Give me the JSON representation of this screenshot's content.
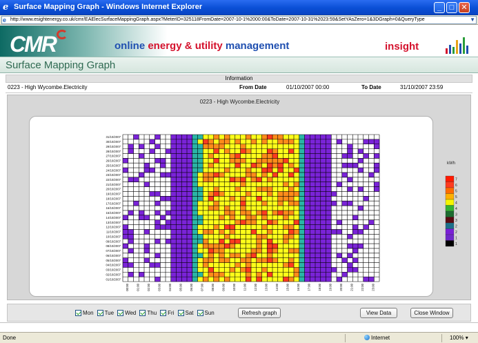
{
  "window": {
    "title": "Surface Mapping Graph - Windows Internet Explorer",
    "url": "http://www.esightenergy.co.uk/cmr/EAElecSurfaceMappingGraph.aspx?MeterID=325118FromDate=2007-10-1%2000:00&ToDate=2007-10-31%2023:59&SetYAsZero=1&3DGraph=0&QueryType"
  },
  "header": {
    "logo_text": "CMR",
    "tagline_online": "online",
    "tagline_energy": "energy & utility",
    "tagline_management": "management",
    "insight": "insight",
    "page_title": "Surface Mapping Graph"
  },
  "info": {
    "heading": "Information",
    "meter": "0223 - High Wycombe.Electricity",
    "from_label": "From Date",
    "from_value": "01/10/2007 00:00",
    "to_label": "To Date",
    "to_value": "31/10/2007 23:59"
  },
  "chart_data": {
    "type": "heatmap",
    "title": "0223 - High Wycombe.Electricity",
    "y_categories": [
      "31/10/2007",
      "30/10/2007",
      "29/10/2007",
      "28/10/2007",
      "27/10/2007",
      "26/10/2007",
      "25/10/2007",
      "24/10/2007",
      "23/10/2007",
      "22/10/2007",
      "21/10/2007",
      "20/10/2007",
      "19/10/2007",
      "18/10/2007",
      "17/10/2007",
      "16/10/2007",
      "15/10/2007",
      "14/10/2007",
      "13/10/2007",
      "12/10/2007",
      "11/10/2007",
      "10/10/2007",
      "09/10/2007",
      "08/10/2007",
      "07/10/2007",
      "06/10/2007",
      "05/10/2007",
      "04/10/2007",
      "03/10/2007",
      "02/10/2007",
      "01/10/2007"
    ],
    "x_categories": [
      "00:00",
      "01:00",
      "02:00",
      "03:00",
      "04:00",
      "05:00",
      "06:00",
      "07:00",
      "08:00",
      "09:00",
      "10:00",
      "11:00",
      "12:00",
      "13:00",
      "14:00",
      "15:00",
      "16:00",
      "17:00",
      "18:00",
      "19:00",
      "20:00",
      "21:00",
      "22:00",
      "23:00"
    ],
    "legend_title": "kWh",
    "legend": [
      {
        "label": "7",
        "color": "#ff1a00"
      },
      {
        "label": "6",
        "color": "#ff3b1f"
      },
      {
        "label": "5",
        "color": "#ff6b00"
      },
      {
        "label": "5",
        "color": "#ffb000"
      },
      {
        "label": "4",
        "color": "#f5f500"
      },
      {
        "label": "4",
        "color": "#34b233"
      },
      {
        "label": "3",
        "color": "#1c6b2f"
      },
      {
        "label": "3",
        "color": "#5a0a12"
      },
      {
        "label": "2",
        "color": "#1c6f8a"
      },
      {
        "label": "2",
        "color": "#7a1fd6"
      },
      {
        "label": "1",
        "color": "#6f28c9"
      },
      {
        "label": "1",
        "color": "#000000"
      }
    ],
    "colors": {
      "low": "#7a23d8",
      "mid": "#2ab5a6",
      "high": "#ffff1a",
      "peak_orange": "#ff8c1a",
      "peak_red": "#ff3b1f"
    },
    "grid": true
  },
  "toolbar": {
    "days": [
      {
        "label": "Mon"
      },
      {
        "label": "Tue"
      },
      {
        "label": "Wed"
      },
      {
        "label": "Thu"
      },
      {
        "label": "Fri"
      },
      {
        "label": "Sat"
      },
      {
        "label": "Sun"
      }
    ],
    "refresh_label": "Refresh graph",
    "view_data_label": "View Data",
    "close_label": "Close Window"
  },
  "status": {
    "left": "Done",
    "zone": "Internet",
    "zoom": "100%"
  }
}
